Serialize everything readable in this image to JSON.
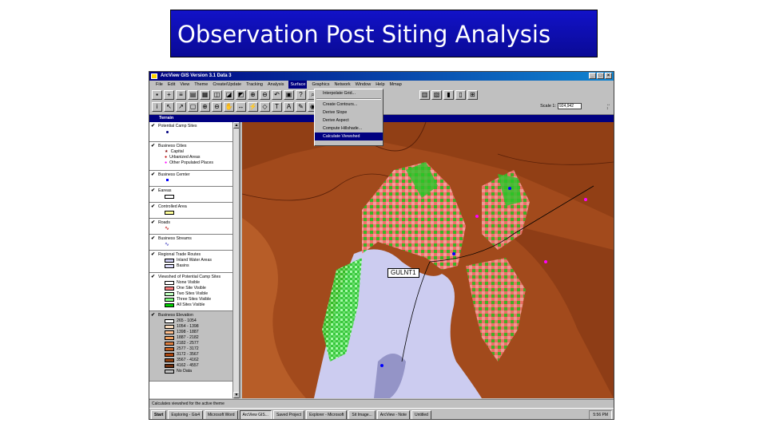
{
  "slide": {
    "title": "Observation Post Siting Analysis"
  },
  "app": {
    "title": "ArcView GIS Version 3.1 Data 3"
  },
  "menubar": [
    "File",
    "Edit",
    "View",
    "Theme",
    "Create/Update",
    "Tracking",
    "Analysis",
    "Surface",
    "Graphics",
    "Network",
    "Window",
    "Help",
    "Mmap"
  ],
  "surface_menu": {
    "items": [
      "Interpolate Grid...",
      "Create Contours...",
      "Derive Slope",
      "Derive Aspect",
      "Compute Hillshade...",
      "Calculate Viewshed"
    ],
    "highlighted": "Calculate Viewshed"
  },
  "toolbar": {
    "scale_label": "Scale 1:",
    "scale_value": "924,942"
  },
  "view": {
    "title": "Terrain"
  },
  "toc": {
    "themes": [
      {
        "name": "Potential Camp Sites",
        "items": []
      },
      {
        "name": "Business Cities",
        "items": [
          "Capital",
          "Urbanized Areas",
          "Other Populated Places"
        ]
      },
      {
        "name": "Business Cemter",
        "items": []
      },
      {
        "name": "Eareas",
        "items": []
      },
      {
        "name": "Controlled Area",
        "items": []
      },
      {
        "name": "Roads",
        "items": []
      },
      {
        "name": "Business Streams",
        "items": []
      },
      {
        "name": "Regional Trade Routes",
        "items": [
          "Inland Water Areas",
          "Basins"
        ]
      },
      {
        "name": "Viewshed of Potential Camp Sites",
        "items": [
          "None Visible",
          "One Site Visible",
          "Two Sites Visible",
          "Three Sites Visible",
          "All Sites Visible"
        ]
      },
      {
        "name": "Business Elevation",
        "items": [
          "265 - 1054",
          "1054 - 1398",
          "1398 - 1887",
          "1887 - 2182",
          "2182 - 2577",
          "2577 - 3172",
          "3172 - 3567",
          "3567 - 4162",
          "4162 - 4557",
          "No Data"
        ]
      }
    ],
    "swatches": {
      "Viewshed of Potential Camp Sites": [
        "#ffffff",
        "#ff8080",
        "#c0ffc0",
        "#80ff80",
        "#00d000"
      ],
      "Business Elevation": [
        "#ffffff",
        "#ffe0c0",
        "#ffc090",
        "#f0a060",
        "#e08040",
        "#c86020",
        "#b04810",
        "#904010",
        "#703010",
        "#c0c0c0"
      ]
    }
  },
  "map": {
    "label": "GULNT1"
  },
  "statusbar": {
    "text": "Calculates viewshed for the active theme"
  },
  "taskbar": {
    "items": [
      "Start",
      "Exploring - Gis4",
      "Microsoft Word",
      "ArcView GIS...",
      "Saved Project",
      "Explorer - Microsoft",
      "Sit Image...",
      "ArcView - Note",
      "Untitled"
    ],
    "clock": "5:56 PM"
  },
  "colors": {
    "title_bg": "#0a0a96",
    "terrain": "#a24a1c",
    "water": "#ccccf0",
    "visible_one": "#ff7878",
    "visible_all": "#28c828"
  }
}
